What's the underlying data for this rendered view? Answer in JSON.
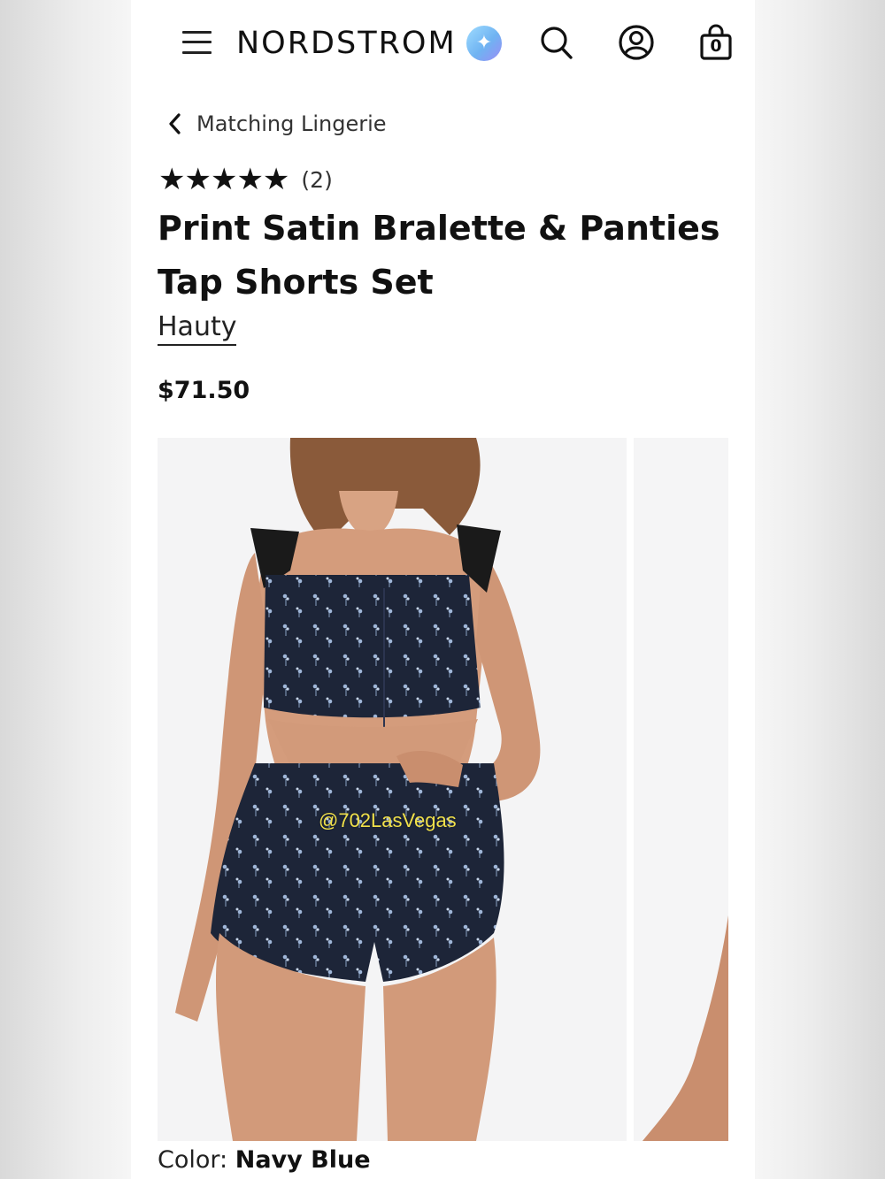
{
  "header": {
    "logo_text": "NORDSTROM",
    "sparkle_icon": "sparkle-ai-icon",
    "icons": [
      "menu-icon",
      "search-icon",
      "account-icon",
      "bag-icon"
    ],
    "bag_count": "0"
  },
  "breadcrumb": {
    "label": "Matching Lingerie"
  },
  "rating": {
    "stars": "★★★★★",
    "count": "(2)"
  },
  "product": {
    "title": "Print Satin Bralette & Panties Tap Shorts Set",
    "brand": "Hauty",
    "price": "$71.50"
  },
  "gallery": {
    "watermark": "@702LasVegas"
  },
  "color": {
    "label": "Color:",
    "value": "Navy Blue"
  }
}
